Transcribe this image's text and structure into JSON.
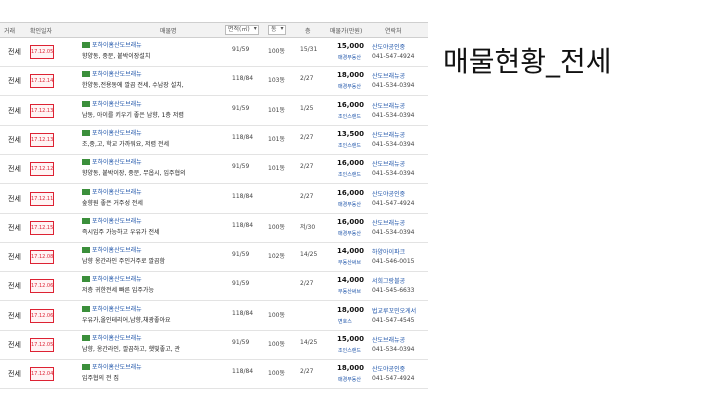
{
  "slide_title": "매물현황_전세",
  "columns": [
    "거래",
    "확인일자",
    "매물명",
    "면적(㎡)",
    "동",
    "층",
    "매물가(만원)",
    "연락처"
  ],
  "rows": [
    {
      "type": "전세",
      "date": "17.12.05",
      "name": "포하이홈산도브래뉴",
      "desc": "향양동, 중문, 붙박이장설치",
      "area": "91/59",
      "bldg": "100동",
      "floor": "15/31",
      "price": "15,000",
      "agency": "매경부동산",
      "contact": "산도야공인중",
      "phone": "041-547-4924"
    },
    {
      "type": "전세",
      "date": "17.12.14",
      "name": "포하이홈산도브래뉴",
      "desc": "한양동,전용동에 깔끔 전세, 수납장 설치,",
      "area": "118/84",
      "bldg": "103동",
      "floor": "2/27",
      "price": "18,000",
      "agency": "매경부동산",
      "contact": "산도브래뉴공",
      "phone": "041-534-0394"
    },
    {
      "type": "전세",
      "date": "17.12.13",
      "name": "포하이홈산도브래뉴",
      "desc": "남동, 아이를 키우기 좋은 남향, 1층 저렴",
      "area": "91/59",
      "bldg": "101동",
      "floor": "1/25",
      "price": "16,000",
      "agency": "조인스랜드",
      "contact": "산도브래뉴공",
      "phone": "041-534-0394"
    },
    {
      "type": "전세",
      "date": "17.12.13",
      "name": "포하이홈산도브래뉴",
      "desc": "조,중,고, 학교 가까워요, 저렴 전세",
      "area": "118/84",
      "bldg": "101동",
      "floor": "2/27",
      "price": "13,500",
      "agency": "조인스랜드",
      "contact": "산도브래뉴공",
      "phone": "041-534-0394"
    },
    {
      "type": "전세",
      "date": "17.12.12",
      "name": "포하이홈산도브래뉴",
      "desc": "향양동, 붙박이장, 중문, 무옵시, 입주협의",
      "area": "91/59",
      "bldg": "101동",
      "floor": "2/27",
      "price": "16,000",
      "agency": "조인스랜드",
      "contact": "산도브래뉴공",
      "phone": "041-534-0394"
    },
    {
      "type": "전세",
      "date": "17.12.11",
      "name": "포하이홈산도브래뉴",
      "desc": "숲향원 좋은 거주성 전세",
      "area": "118/84",
      "bldg": "",
      "floor": "2/27",
      "price": "16,000",
      "agency": "매경부동산",
      "contact": "산도야공인중",
      "phone": "041-547-4924"
    },
    {
      "type": "전세",
      "date": "17.12.15",
      "name": "포하이홈산도브래뉴",
      "desc": "즉시입주 가능하고 우유가 전세",
      "area": "118/84",
      "bldg": "100동",
      "floor": "저/30",
      "price": "16,000",
      "agency": "매경부동산",
      "contact": "산도브래뉴공",
      "phone": "041-534-0394"
    },
    {
      "type": "전세",
      "date": "17.12.08",
      "name": "포하이홈산도브래뉴",
      "desc": "남향 옹간라인 주인거주로 깔끔함",
      "area": "91/59",
      "bldg": "102동",
      "floor": "14/25",
      "price": "14,000",
      "agency": "부동산써브",
      "contact": "하양아이파크",
      "phone": "041-546-0015"
    },
    {
      "type": "전세",
      "date": "17.12.06",
      "name": "포하이홈산도브래뉴",
      "desc": "저층 귀한전세 빠른 입주가능",
      "area": "91/59",
      "bldg": "",
      "floor": "2/27",
      "price": "14,000",
      "agency": "부동산써브",
      "contact": "서희그랑블공",
      "phone": "041-545-6633"
    },
    {
      "type": "전세",
      "date": "17.12.06",
      "name": "포하이홈산도브래뉴",
      "desc": "우유가,올인테리어,남향,채광좋아요",
      "area": "118/84",
      "bldg": "100동",
      "floor": "",
      "price": "18,000",
      "agency": "변호스",
      "contact": "법교루꼬민오게서",
      "phone": "041-547-4545"
    },
    {
      "type": "전세",
      "date": "17.12.05",
      "name": "포하이홈산도브래뉴",
      "desc": "남향, 옹간라인, 깔끔하고, 햇빛좋고, 관",
      "area": "91/59",
      "bldg": "100동",
      "floor": "14/25",
      "price": "15,000",
      "agency": "조인스랜드",
      "contact": "산도브래뉴공",
      "phone": "041-534-0394"
    },
    {
      "type": "전세",
      "date": "17.12.04",
      "name": "포하이홈산도브래뉴",
      "desc": "입주협의 전 집",
      "area": "118/84",
      "bldg": "100동",
      "floor": "2/27",
      "price": "18,000",
      "agency": "매경부동산",
      "contact": "산도야공인중",
      "phone": "041-547-4924"
    }
  ]
}
